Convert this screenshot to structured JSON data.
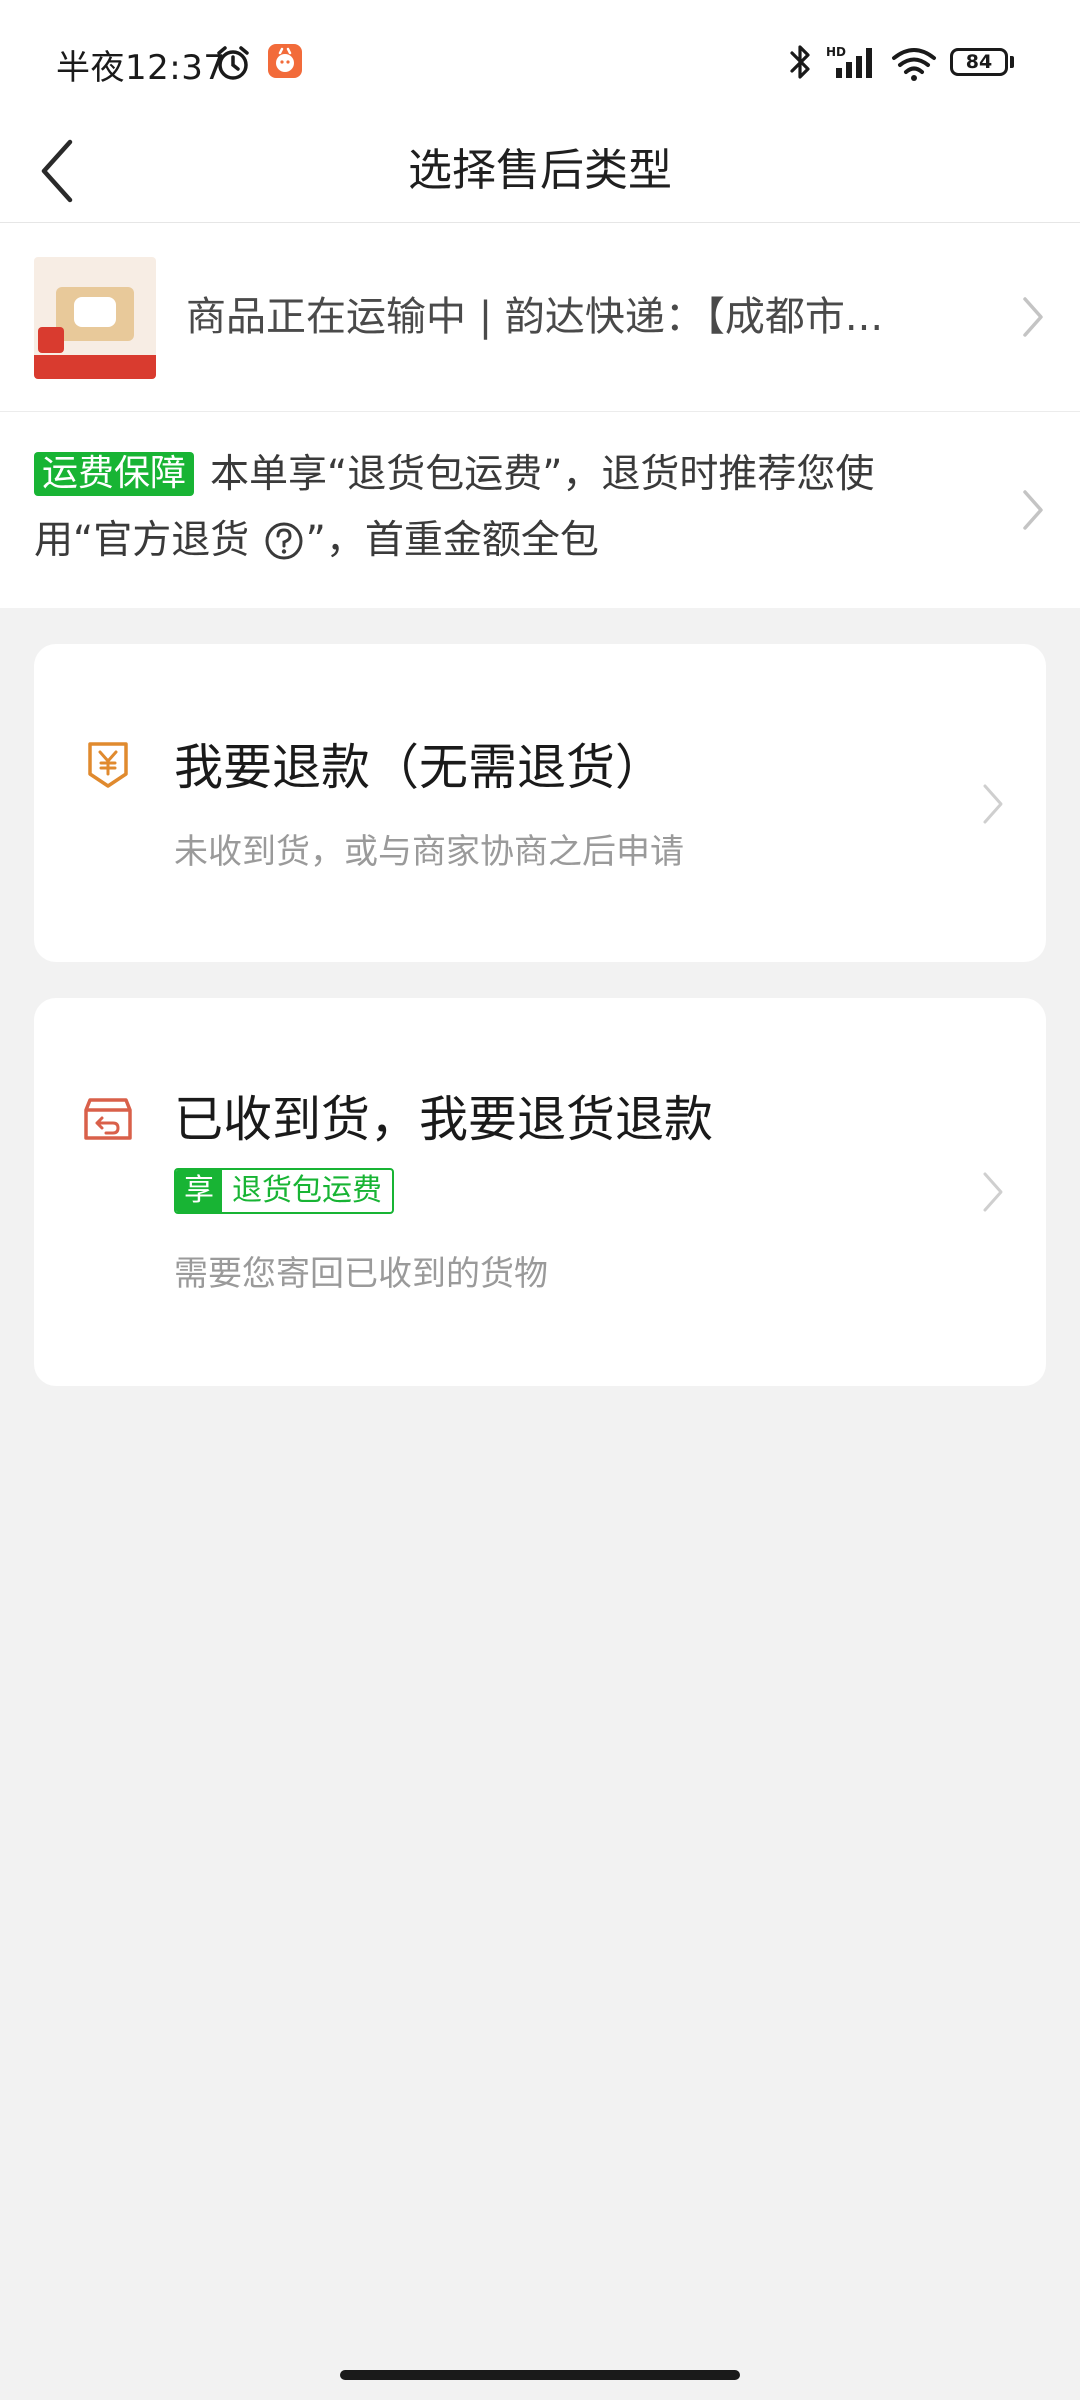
{
  "status_bar": {
    "time": "半夜12:37",
    "battery": "84",
    "icons": [
      "alarm-icon",
      "app-notification-icon",
      "bluetooth-icon",
      "hd-signal-icon",
      "wifi-icon",
      "battery-icon"
    ]
  },
  "header": {
    "title": "选择售后类型",
    "back_icon": "chevron-left-icon"
  },
  "shipping": {
    "text": "商品正在运输中 | 韵达快递：【成都市..."
  },
  "notice": {
    "badge": "运费保障",
    "text_before": "本单享“退货包运费”，退货时推荐您使用“官方退货",
    "text_after": "”，首重金额全包"
  },
  "options": {
    "refund": {
      "title": "我要退款（无需退货）",
      "description": "未收到货，或与商家协商之后申请",
      "icon": "yuan-shield-icon"
    },
    "return": {
      "title": "已收到货，我要退货退款",
      "tag_prefix": "享",
      "tag_label": "退货包运费",
      "description": "需要您寄回已收到的货物",
      "icon": "return-box-icon"
    }
  },
  "colors": {
    "accent_green": "#18b434",
    "icon_orange": "#e08a2e",
    "icon_red": "#d9604a",
    "background": "#f2f2f2"
  }
}
